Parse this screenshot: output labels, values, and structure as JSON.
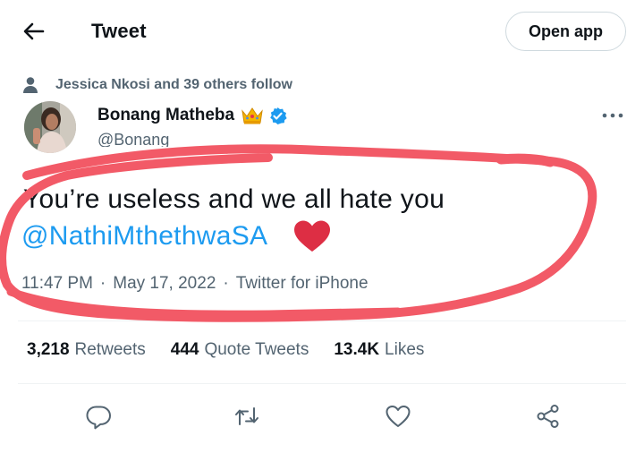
{
  "header": {
    "back_icon": "arrow-left-icon",
    "title": "Tweet",
    "open_app_label": "Open app"
  },
  "social_context": {
    "icon": "person-icon",
    "text": "Jessica Nkosi and 39 others follow"
  },
  "tweet": {
    "author_name": "Bonang Matheba",
    "author_handle": "@Bonang",
    "text": "You’re useless and we all hate you",
    "mention": "@NathiMthethwaSA",
    "emoji": "red-heart",
    "time": "11:47 PM",
    "date": "May 17, 2022",
    "source": "Twitter for iPhone",
    "separator": "·"
  },
  "stats": {
    "retweets_count": "3,218",
    "retweets_label": "Retweets",
    "quotes_count": "444",
    "quotes_label": "Quote Tweets",
    "likes_count": "13.4K",
    "likes_label": "Likes"
  },
  "actions": [
    "reply-icon",
    "retweet-icon",
    "like-icon",
    "share-icon"
  ],
  "colors": {
    "link_blue": "#1d9bf0",
    "secondary_text": "#536471",
    "scribble_red": "#f25a67",
    "verified_blue": "#1d9bf0"
  }
}
